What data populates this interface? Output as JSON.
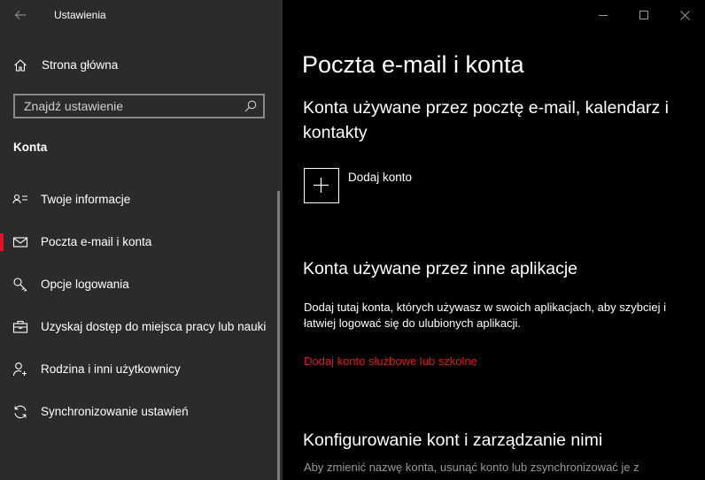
{
  "window": {
    "title": "Ustawienia"
  },
  "sidebar": {
    "home_label": "Strona główna",
    "search": {
      "placeholder": "Znajdź ustawienie"
    },
    "section_title": "Konta",
    "items": [
      {
        "label": "Twoje informacje",
        "icon": "person-card-icon",
        "selected": false
      },
      {
        "label": "Poczta e-mail i konta",
        "icon": "mail-icon",
        "selected": true
      },
      {
        "label": "Opcje logowania",
        "icon": "key-icon",
        "selected": false
      },
      {
        "label": "Uzyskaj dostęp do miejsca pracy lub nauki",
        "icon": "briefcase-icon",
        "selected": false
      },
      {
        "label": "Rodzina i inni użytkownicy",
        "icon": "add-person-icon",
        "selected": false
      },
      {
        "label": "Synchronizowanie ustawień",
        "icon": "sync-icon",
        "selected": false
      }
    ]
  },
  "main": {
    "page_title": "Poczta e-mail i konta",
    "section1_title": "Konta używane przez pocztę e-mail, kalendarz i kontakty",
    "add_account_label": "Dodaj konto",
    "section2_title": "Konta używane przez inne aplikacje",
    "section2_desc": "Dodaj tutaj konta, których używasz w swoich aplikacjach, aby szybciej i łatwiej logować się do ulubionych aplikacji.",
    "section2_link": "Dodaj konto służbowe lub szkolne",
    "section3_title": "Konfigurowanie kont i zarządzanie nimi",
    "section3_desc": "Aby zmienić nazwę konta, usunąć konto lub zsynchronizować je z"
  },
  "colors": {
    "sidebar_bg": "#2b2b2b",
    "main_bg": "#000000",
    "accent": "#e81123"
  }
}
